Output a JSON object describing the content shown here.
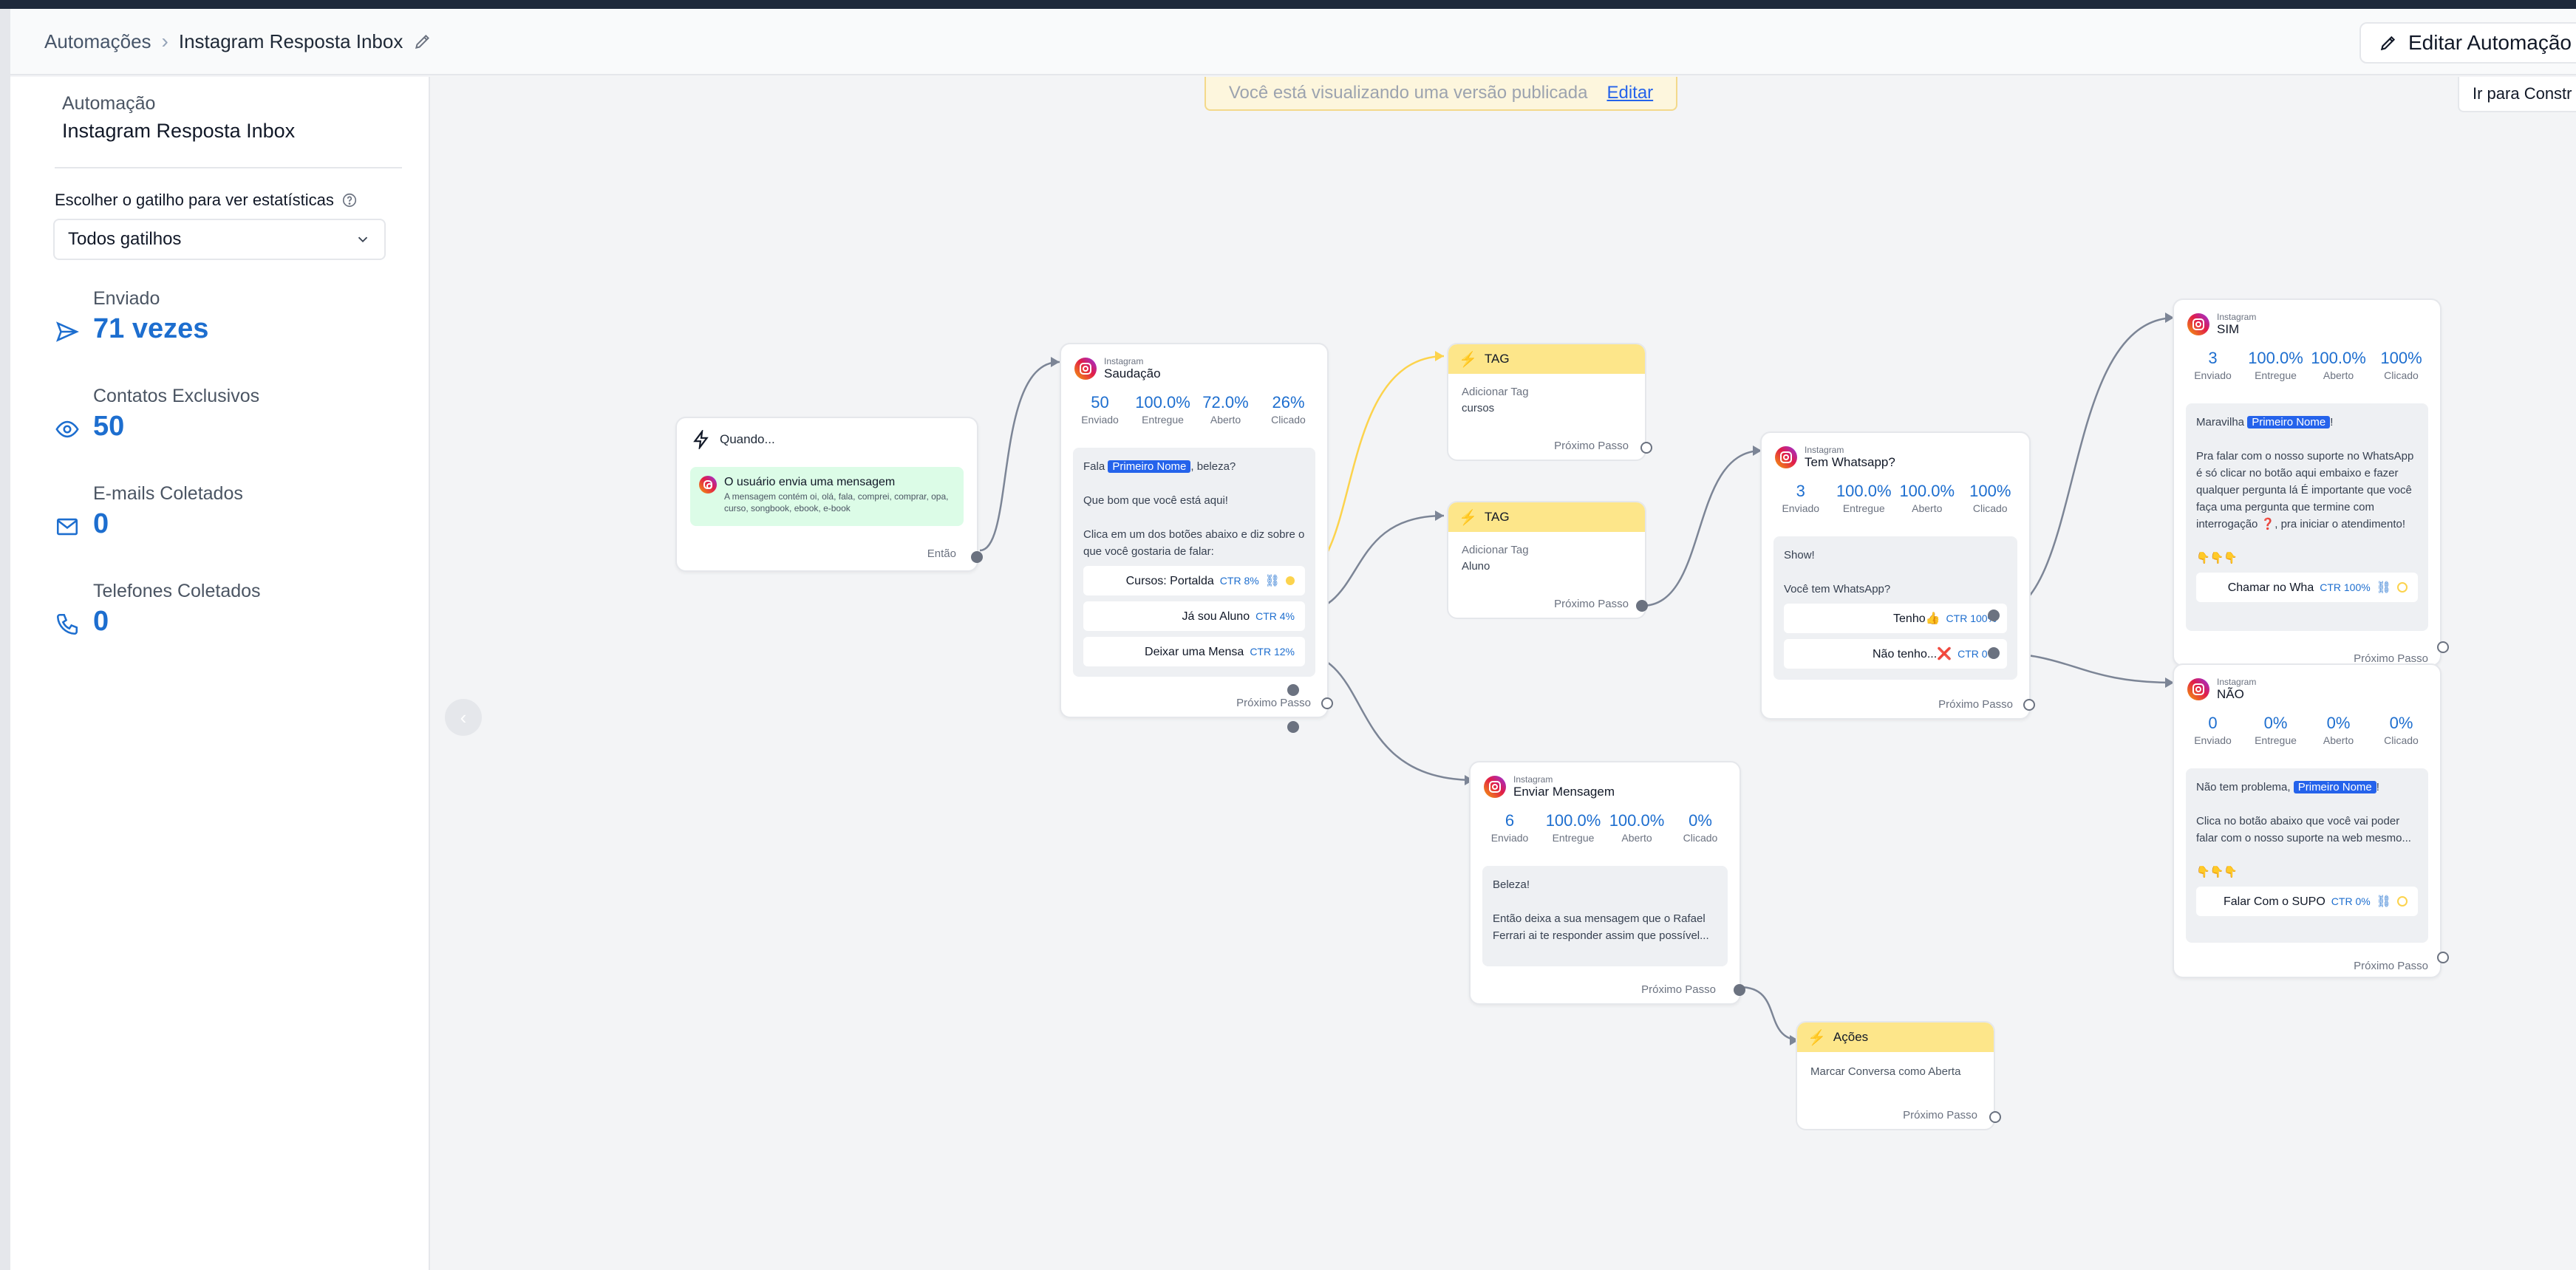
{
  "header": {
    "breadcrumb_root": "Automações",
    "breadcrumb_current": "Instagram Resposta Inbox",
    "edit_button": "Editar Automação"
  },
  "sidebar": {
    "label": "Automação",
    "name": "Instagram Resposta Inbox",
    "trigger_label": "Escolher o gatilho para ver estatísticas",
    "trigger_value": "Todos gatilhos",
    "stats": [
      {
        "label": "Enviado",
        "value": "71 vezes",
        "icon": "send-icon"
      },
      {
        "label": "Contatos Exclusivos",
        "value": "50",
        "icon": "eye-icon"
      },
      {
        "label": "E-mails Coletados",
        "value": "0",
        "icon": "mail-icon"
      },
      {
        "label": "Telefones Coletados",
        "value": "0",
        "icon": "phone-icon"
      }
    ]
  },
  "canvas": {
    "banner_text": "Você está visualizando uma versão publicada",
    "banner_link": "Editar",
    "builder_button": "Ir para Constr",
    "collapse_icon": "chevron-left-icon"
  },
  "trigger_node": {
    "title": "Quando...",
    "event_title": "O usuário envia uma mensagem",
    "event_detail": "A mensagem contém oi, olá, fala, comprei, comprar, opa, curso, songbook, ebook, e-book",
    "next": "Então"
  },
  "saudacao": {
    "source": "Instagram",
    "title": "Saudação",
    "metrics": [
      {
        "value": "50",
        "label": "Enviado"
      },
      {
        "value": "100.0%",
        "label": "Entregue"
      },
      {
        "value": "72.0%",
        "label": "Aberto"
      },
      {
        "value": "26%",
        "label": "Clicado"
      }
    ],
    "msg_pre": "Fala",
    "msg_tag": "Primeiro Nome",
    "msg_post": ", beleza?",
    "msg_line2": "Que bom que você está aqui!",
    "msg_line3": "Clica em um dos botões abaixo e diz sobre o que você gostaria de falar:",
    "buttons": [
      {
        "label": "Cursos: Portalda",
        "ctr": "CTR 8%"
      },
      {
        "label": "Já sou Aluno",
        "ctr": "CTR 4%"
      },
      {
        "label": "Deixar uma Mensa",
        "ctr": "CTR 12%"
      }
    ],
    "next": "Próximo Passo"
  },
  "tag1": {
    "title": "TAG",
    "label": "Adicionar Tag",
    "value": "cursos",
    "next": "Próximo Passo"
  },
  "tag2": {
    "title": "TAG",
    "label": "Adicionar Tag",
    "value": "Aluno",
    "next": "Próximo Passo"
  },
  "whatsapp": {
    "source": "Instagram",
    "title": "Tem Whatsapp?",
    "metrics": [
      {
        "value": "3",
        "label": "Enviado"
      },
      {
        "value": "100.0%",
        "label": "Entregue"
      },
      {
        "value": "100.0%",
        "label": "Aberto"
      },
      {
        "value": "100%",
        "label": "Clicado"
      }
    ],
    "msg_line1": "Show!",
    "msg_line2": "Você tem WhatsApp?",
    "buttons": [
      {
        "label": "Tenho👍",
        "ctr": "CTR 100%"
      },
      {
        "label": "Não tenho...❌",
        "ctr": "CTR 0%"
      }
    ],
    "next": "Próximo Passo"
  },
  "enviar": {
    "source": "Instagram",
    "title": "Enviar Mensagem",
    "metrics": [
      {
        "value": "6",
        "label": "Enviado"
      },
      {
        "value": "100.0%",
        "label": "Entregue"
      },
      {
        "value": "100.0%",
        "label": "Aberto"
      },
      {
        "value": "0%",
        "label": "Clicado"
      }
    ],
    "msg_line1": "Beleza!",
    "msg_line2": "Então deixa a sua mensagem que o Rafael Ferrari ai te responder assim que possível...",
    "next": "Próximo Passo"
  },
  "acoes": {
    "title": "Ações",
    "text": "Marcar Conversa como Aberta",
    "next": "Próximo Passo"
  },
  "sim": {
    "source": "Instagram",
    "title": "SIM",
    "metrics": [
      {
        "value": "3",
        "label": "Enviado"
      },
      {
        "value": "100.0%",
        "label": "Entregue"
      },
      {
        "value": "100.0%",
        "label": "Aberto"
      },
      {
        "value": "100%",
        "label": "Clicado"
      }
    ],
    "msg_pre": "Maravilha",
    "msg_tag": "Primeiro Nome",
    "msg_post": "!",
    "msg_line2": "Pra falar com o nosso suporte no WhatsApp é só clicar no botão aqui embaixo e fazer qualquer pergunta lá É importante que você faça uma pergunta que termine com interrogação ❓, pra iniciar o atendimento!",
    "msg_line3": "👇👇👇",
    "button": {
      "label": "Chamar no Wha",
      "ctr": "CTR 100%"
    },
    "next": "Próximo Passo"
  },
  "nao": {
    "source": "Instagram",
    "title": "NÃO",
    "metrics": [
      {
        "value": "0",
        "label": "Enviado"
      },
      {
        "value": "0%",
        "label": "Entregue"
      },
      {
        "value": "0%",
        "label": "Aberto"
      },
      {
        "value": "0%",
        "label": "Clicado"
      }
    ],
    "msg_pre": "Não tem problema,",
    "msg_tag": "Primeiro Nome",
    "msg_post": "!",
    "msg_line2": "Clica no botão abaixo que você vai poder falar com o nosso suporte na web mesmo...",
    "msg_line3": "👇👇👇",
    "button": {
      "label": "Falar Com o SUPO",
      "ctr": "CTR 0%"
    },
    "next": "Próximo Passo"
  },
  "colors": {
    "accent": "#1d6ecf",
    "tag_header": "#fde68a",
    "edge": "#7c8596",
    "edge_highlight": "#fcd34d"
  }
}
